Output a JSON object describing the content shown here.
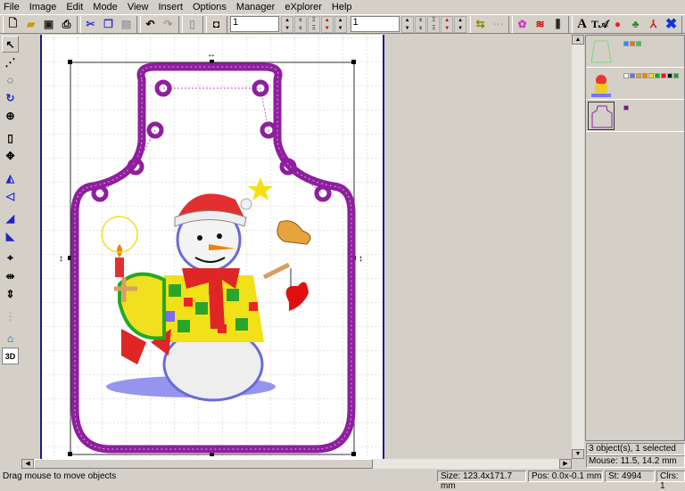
{
  "menu": [
    "File",
    "Image",
    "Edit",
    "Mode",
    "View",
    "Insert",
    "Options",
    "Manager",
    "eXplorer",
    "Help"
  ],
  "toolbar": {
    "input1": "1",
    "input2": "1",
    "text_tool": "A",
    "threed": "3D"
  },
  "objects": [
    {
      "name": "outline-green",
      "colors": [
        "#1e90ff",
        "#ff6a13",
        "#22dd22"
      ]
    },
    {
      "name": "snowman",
      "colors": [
        "#f4f4f4",
        "#6a6aff",
        "#ff9a10",
        "#ff7b00",
        "#f0e000",
        "#11aa11",
        "#ee1111",
        "#111111",
        "#11aa11"
      ]
    },
    {
      "name": "apron-outline",
      "colors": [
        "#8b008b"
      ]
    }
  ],
  "right_status": {
    "selection": "3 object(s), 1 selected",
    "mouse": "Mouse: 11.5, 14.2 mm"
  },
  "status": {
    "hint": "Drag mouse to move objects",
    "size": "Size: 123.4x171.7 mm",
    "pos": "Pos: 0.0x-0.1 mm",
    "stitches": "St: 4994",
    "colors": "Clrs: 1"
  }
}
